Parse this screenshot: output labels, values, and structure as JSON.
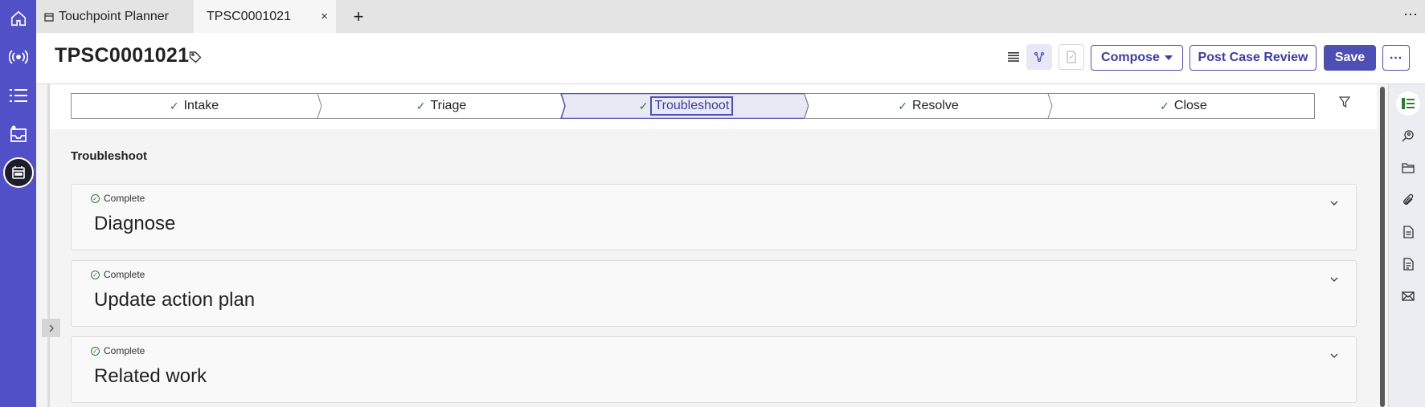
{
  "tabs": {
    "planner_label": "Touchpoint Planner",
    "case_label": "TPSC0001021",
    "close_symbol": "×",
    "add_symbol": "+",
    "more_symbol": "⋯"
  },
  "header": {
    "case_id": "TPSC0001021",
    "compose_label": "Compose",
    "post_case_review_label": "Post Case Review",
    "save_label": "Save",
    "more_symbol": "⋯"
  },
  "stages": [
    {
      "label": "Intake",
      "check": "✓"
    },
    {
      "label": "Triage",
      "check": "✓"
    },
    {
      "label": "Troubleshoot",
      "check": "✓"
    },
    {
      "label": "Resolve",
      "check": "✓"
    },
    {
      "label": "Close",
      "check": "✓"
    }
  ],
  "section": {
    "title": "Troubleshoot",
    "cards": [
      {
        "status": "Complete",
        "title": "Diagnose"
      },
      {
        "status": "Complete",
        "title": "Update action plan"
      },
      {
        "status": "Complete",
        "title": "Related work"
      }
    ]
  },
  "colors": {
    "brand": "#5150c6",
    "accent": "#4d4fb4",
    "success": "#2e7d32"
  },
  "icons": {
    "left_rail": [
      "home-icon",
      "broadcast-icon",
      "list-icon",
      "inbox-icon",
      "calendar-icon"
    ],
    "right_rail": [
      "details-icon",
      "search-person-icon",
      "folder-icon",
      "attachment-icon",
      "document-icon",
      "document-alt-icon",
      "email-icon"
    ]
  }
}
